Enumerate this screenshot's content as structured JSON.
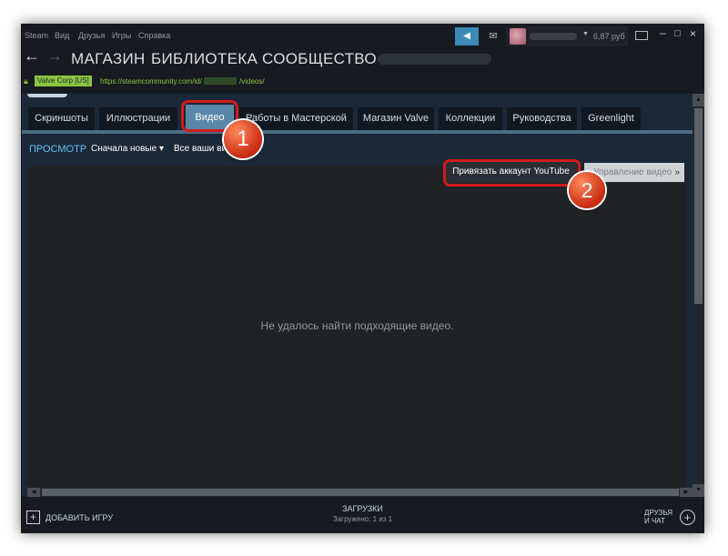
{
  "titlebar": {
    "menu": [
      "Steam",
      "Вид",
      "Друзья",
      "Игры",
      "Справка"
    ],
    "wallet": "6,87 руб",
    "icons": {
      "broadcast": "megaphone-icon",
      "notifications": "envelope-icon",
      "minimize": "–",
      "maximize": "□",
      "close": "×"
    }
  },
  "nav": {
    "back": "←",
    "forward": "→",
    "links": [
      "МАГАЗИН",
      "БИБЛИОТЕКА",
      "СООБЩЕСТВО"
    ]
  },
  "urlbar": {
    "cert": "Valve Corp [US]",
    "url_prefix": "https://steamcommunity.com/id/",
    "url_suffix": "/videos/"
  },
  "tabs": [
    {
      "label": "Скриншоты",
      "active": false
    },
    {
      "label": "Иллюстрации",
      "active": false
    },
    {
      "label": "Видео",
      "active": true
    },
    {
      "label": "Работы в Мастерской",
      "active": false
    },
    {
      "label": "Магазин Valve",
      "active": false
    },
    {
      "label": "Коллекции",
      "active": false
    },
    {
      "label": "Руководства",
      "active": false
    },
    {
      "label": "Greenlight",
      "active": false
    }
  ],
  "filters": {
    "view_label": "ПРОСМОТР",
    "sort": "Сначала новые",
    "all_videos": "Все ваши видео"
  },
  "actions": {
    "youtube_button": "Привязать аккаунт YouTube",
    "manage_dropdown": "Управление видео"
  },
  "video_panel": {
    "empty_message": "Не удалось найти подходящие видео."
  },
  "markers": [
    "1",
    "2"
  ],
  "bottombar": {
    "add_game": "ДОБАВИТЬ ИГРУ",
    "downloads_title": "ЗАГРУЗКИ",
    "downloads_status": "Загружено: 1 из 1",
    "friends_line1": "ДРУЗЬЯ",
    "friends_line2": "И ЧАТ"
  },
  "colors": {
    "accent": "#66c0f4",
    "active_tab": "#5a87a8",
    "annotation": "#d11b1b",
    "secure": "#8bc53f"
  }
}
